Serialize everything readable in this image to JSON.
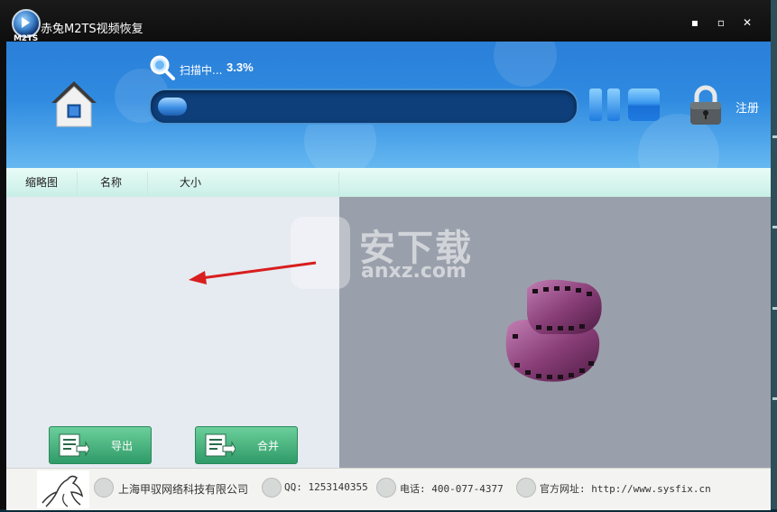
{
  "window": {
    "logo_text": "M2TS",
    "title": "赤兔M2TS视频恢复",
    "minimize_label": "▪",
    "maximize_label": "▫",
    "close_label": "✕"
  },
  "header": {
    "scan_label": "扫描中...",
    "scan_percent": "3.3%",
    "progress_fraction": 0.033,
    "register_label": "注册"
  },
  "columns": [
    "缩略图",
    "名称",
    "大小"
  ],
  "actions": {
    "export_label": "导出",
    "merge_label": "合并"
  },
  "footer": {
    "company": "上海甲驭网络科技有限公司",
    "qq": "QQ: 1253140355",
    "phone": "电话: 400-077-4377",
    "website": "官方网址: http://www.sysfix.cn"
  },
  "watermark": {
    "text_cn": "安下载",
    "text_en": "anxz.com"
  },
  "colors": {
    "header_blue": "#2f8ae0",
    "button_green": "#2f9b68",
    "film_purple": "#8a3f78"
  }
}
